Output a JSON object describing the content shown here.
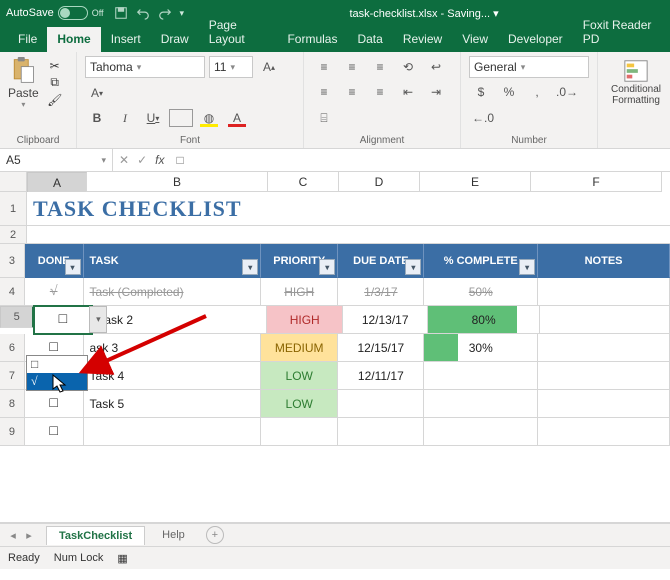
{
  "titlebar": {
    "autosave_label": "AutoSave",
    "autosave_state": "Off",
    "filename": "task-checklist.xlsx",
    "filestate": "Saving..."
  },
  "ribbon": {
    "tabs": [
      "File",
      "Home",
      "Insert",
      "Draw",
      "Page Layout",
      "Formulas",
      "Data",
      "Review",
      "View",
      "Developer",
      "Foxit Reader PD"
    ],
    "active_tab": "Home",
    "clipboard": {
      "paste_label": "Paste",
      "group_label": "Clipboard"
    },
    "font": {
      "name": "Tahoma",
      "size": "11",
      "group_label": "Font"
    },
    "alignment": {
      "group_label": "Alignment"
    },
    "number": {
      "format": "General",
      "group_label": "Number"
    },
    "cond_fmt": "Conditional Formatting"
  },
  "formula_bar": {
    "cell_ref": "A5",
    "formula": "□"
  },
  "columns": [
    "A",
    "B",
    "C",
    "D",
    "E",
    "F"
  ],
  "table": {
    "title": "TASK CHECKLIST",
    "headers": {
      "done": "DONE",
      "task": "TASK",
      "priority": "PRIORITY",
      "due": "DUE DATE",
      "pct": "% COMPLETE",
      "notes": "NOTES"
    },
    "rows": [
      {
        "done": "√",
        "task": "Task (Completed)",
        "priority": "HIGH",
        "due": "1/3/17",
        "pct_label": "50%",
        "pct_val": 50,
        "strike": true,
        "pclass": ""
      },
      {
        "done": "□",
        "task": "Task 2",
        "priority": "HIGH",
        "due": "12/13/17",
        "pct_label": "80%",
        "pct_val": 80,
        "strike": false,
        "pclass": "pc-high"
      },
      {
        "done": "□",
        "task": "ask 3",
        "priority": "MEDIUM",
        "due": "12/15/17",
        "pct_label": "30%",
        "pct_val": 30,
        "strike": false,
        "pclass": "pc-med"
      },
      {
        "done": "□",
        "task": "Task 4",
        "priority": "LOW",
        "due": "12/11/17",
        "pct_label": "",
        "pct_val": 0,
        "strike": false,
        "pclass": "pc-low"
      },
      {
        "done": "□",
        "task": "Task 5",
        "priority": "LOW",
        "due": "",
        "pct_label": "",
        "pct_val": 0,
        "strike": false,
        "pclass": "pc-low"
      },
      {
        "done": "□",
        "task": "",
        "priority": "",
        "due": "",
        "pct_label": "",
        "pct_val": 0,
        "strike": false,
        "pclass": ""
      }
    ],
    "dropdown": {
      "opt1": "□",
      "opt2": "√"
    }
  },
  "sheets": {
    "active": "TaskChecklist",
    "other": "Help"
  },
  "status": {
    "ready": "Ready",
    "numlock": "Num Lock"
  }
}
